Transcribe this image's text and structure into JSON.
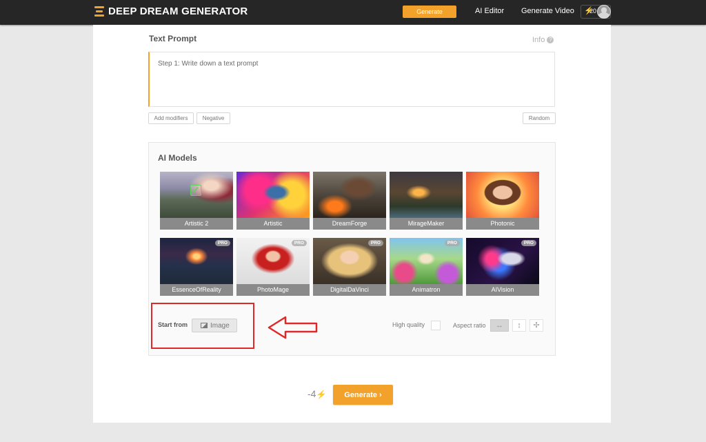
{
  "header": {
    "brand": "DEEP DREAM GENERATOR",
    "generate_label": "Generate",
    "ai_editor": "AI Editor",
    "generate_video": "Generate Video",
    "energy_count": "20"
  },
  "prompt": {
    "title": "Text Prompt",
    "info": "Info",
    "placeholder": "Step 1: Write down a text prompt",
    "value": "",
    "add_modifiers": "Add modifiers",
    "negative": "Negative",
    "random": "Random"
  },
  "models": {
    "title": "AI Models",
    "items": [
      {
        "label": "Artistic 2",
        "selected": true,
        "pro": false
      },
      {
        "label": "Artistic",
        "selected": false,
        "pro": false
      },
      {
        "label": "DreamForge",
        "selected": false,
        "pro": false
      },
      {
        "label": "MirageMaker",
        "selected": false,
        "pro": false
      },
      {
        "label": "Photonic",
        "selected": false,
        "pro": false
      },
      {
        "label": "EssenceOfReality",
        "selected": false,
        "pro": true,
        "badge": "PRO"
      },
      {
        "label": "PhotoMage",
        "selected": false,
        "pro": true,
        "badge": "PRO"
      },
      {
        "label": "DigitalDaVinci",
        "selected": false,
        "pro": true,
        "badge": "PRO"
      },
      {
        "label": "Animatron",
        "selected": false,
        "pro": true,
        "badge": "PRO"
      },
      {
        "label": "AIVision",
        "selected": false,
        "pro": true,
        "badge": "PRO"
      }
    ],
    "start_from": "Start from",
    "image_label": "Image",
    "high_quality": "High quality",
    "aspect_ratio": "Aspect ratio"
  },
  "generate": {
    "cost": "-4",
    "label": "Generate"
  },
  "colors": {
    "accent": "#f2a22a",
    "topbar": "#262626",
    "annotation": "#e0282b"
  }
}
